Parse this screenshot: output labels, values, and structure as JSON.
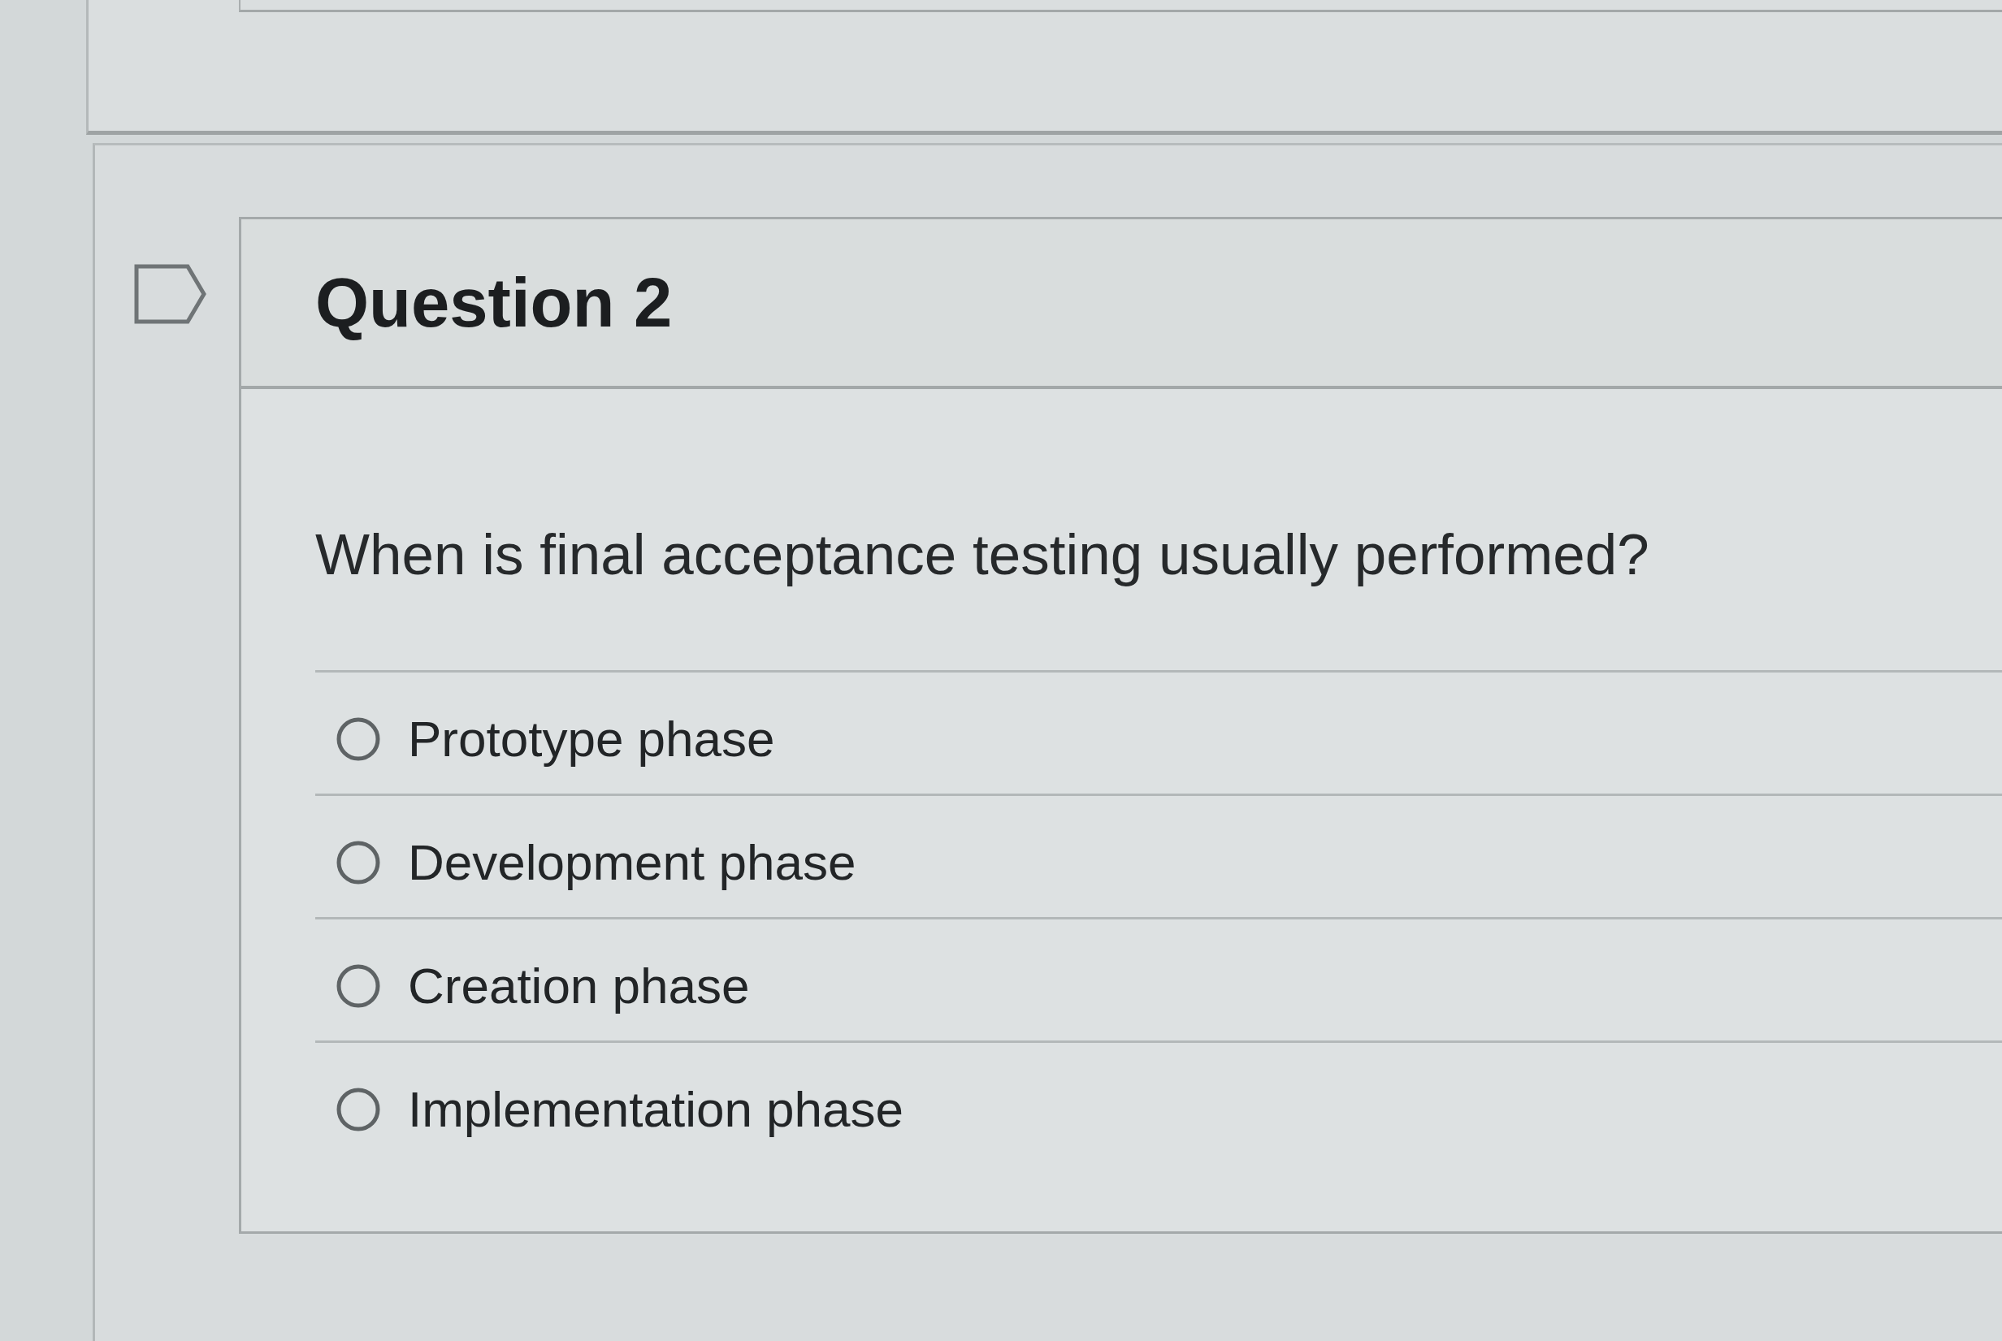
{
  "question": {
    "title": "Question 2",
    "flagged": false,
    "text": "When is final acceptance testing usually performed?",
    "options": [
      {
        "label": "Prototype phase",
        "selected": false
      },
      {
        "label": "Development phase",
        "selected": false
      },
      {
        "label": "Creation phase",
        "selected": false
      },
      {
        "label": "Implementation phase",
        "selected": false
      }
    ]
  }
}
